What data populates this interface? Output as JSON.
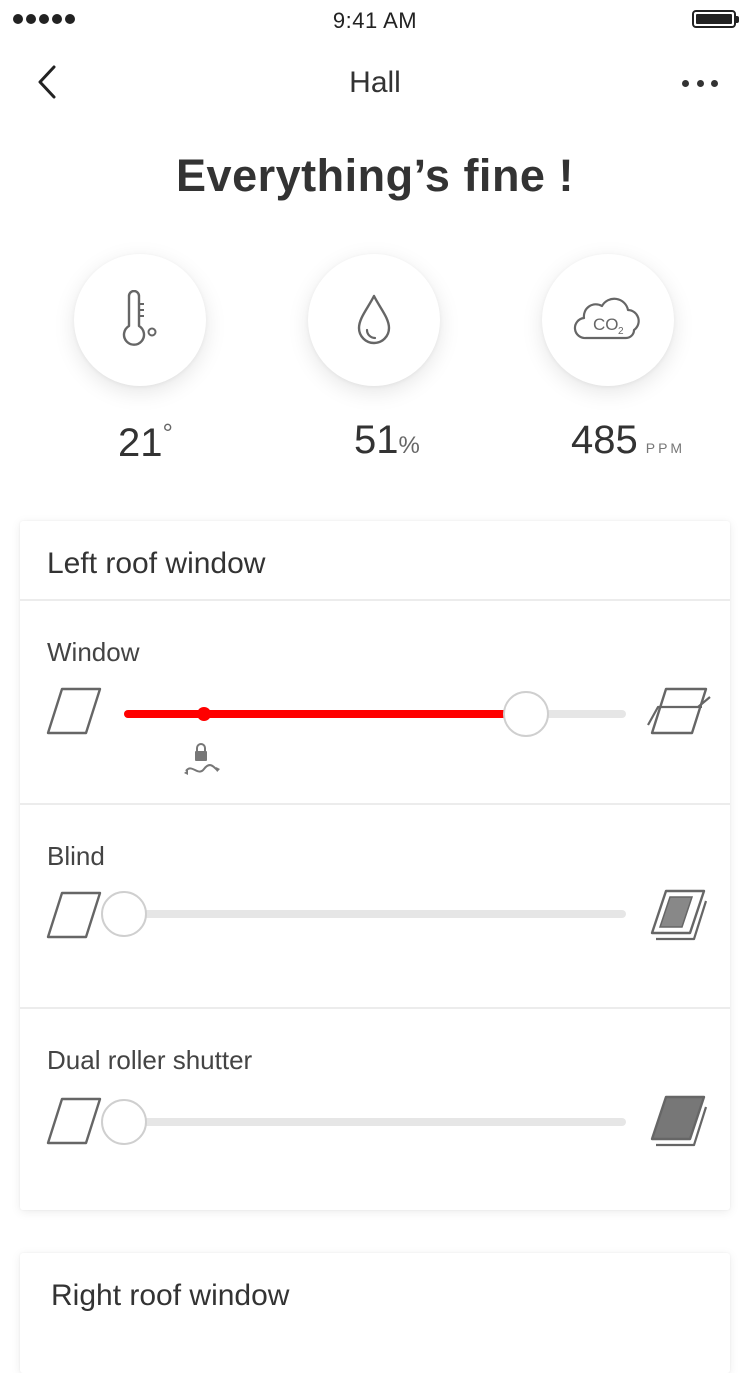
{
  "status_bar": {
    "time": "9:41 AM"
  },
  "nav": {
    "title": "Hall"
  },
  "headline": "Everything’s fine !",
  "sensors": {
    "temperature": {
      "value": "21",
      "unit": "°",
      "icon": "thermometer-icon"
    },
    "humidity": {
      "value": "51",
      "unit": "%",
      "icon": "water-drop-icon"
    },
    "co2": {
      "value": "485",
      "unit": "PPM",
      "icon": "co2-cloud-icon",
      "icon_text": "CO",
      "icon_sub": "2"
    }
  },
  "cards": {
    "left": {
      "title": "Left roof window",
      "rows": [
        {
          "label": "Window",
          "level": 0.8,
          "limit_level": 0.16,
          "fill_color": "#ff0000",
          "icon_start": "window-closed-icon",
          "icon_end": "window-open-icon",
          "limit_icon": "lock-ventilation-icon"
        },
        {
          "label": "Blind",
          "level": 0.0,
          "icon_start": "window-closed-icon",
          "icon_end": "blind-icon"
        },
        {
          "label": "Dual roller shutter",
          "level": 0.0,
          "icon_start": "window-closed-icon",
          "icon_end": "roller-shutter-icon"
        }
      ]
    },
    "right": {
      "title": "Right roof window"
    }
  },
  "colors": {
    "accent": "#ff0000",
    "track": "#e6e6e6",
    "text": "#333333"
  }
}
